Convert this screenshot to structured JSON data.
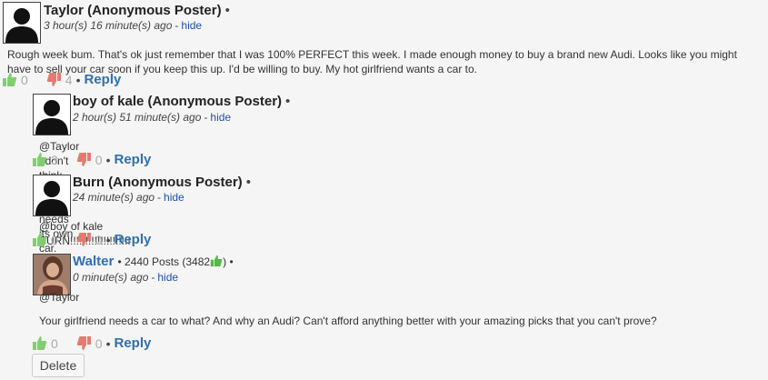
{
  "comments": [
    {
      "author": "Taylor (Anonymous Poster)",
      "bullet": "•",
      "time": "3 hour(s) 16 minute(s) ago",
      "sep": "-",
      "hide": "hide",
      "body": "Rough week bum. That's ok just remember that I was 100% PERFECT this week. I made enough money to buy a brand new Audi. Looks like you might have to sell your car soon if you keep this up. I'd be willing to buy. My hot girlfriend wants a car to.",
      "up": "0",
      "down": "4",
      "reply_sep": "•",
      "reply": "Reply"
    },
    {
      "author": "boy of kale (Anonymous Poster)",
      "bullet": "•",
      "time": "2 hour(s) 51 minute(s) ago",
      "sep": "-",
      "hide": "hide",
      "body": "@Taylor I don't think your hand needs its own car.",
      "up": "3",
      "down": "0",
      "reply_sep": "•",
      "reply": "Reply"
    },
    {
      "author": "Burn (Anonymous Poster)",
      "bullet": "•",
      "time": "24 minute(s) ago",
      "sep": "-",
      "hide": "hide",
      "body": "@boy of kale BURN!!!!!!!!!!!!!!!!!!!!",
      "up": "0",
      "down": "0",
      "reply_sep": "•",
      "reply": "Reply"
    },
    {
      "author": "Walter",
      "bullet": "•",
      "posts": "2440 Posts (3482",
      "posts_close": ")",
      "time": "0 minute(s) ago",
      "sep": "-",
      "hide": "hide",
      "body_line1": "@Taylor",
      "body_line2": "Your girlfriend needs a car to what? And why an Audi? Can't afford anything better with your amazing picks that you can't prove?",
      "up": "0",
      "down": "0",
      "reply_sep": "•",
      "reply": "Reply",
      "delete": "Delete"
    }
  ],
  "icons": {
    "avatar": "anonymous-avatar-icon",
    "thumb_up": "thumbs-up-icon",
    "thumb_down": "thumbs-down-icon"
  },
  "colors": {
    "link": "#2f6fb3",
    "hide_link": "#1f4fb0",
    "thumb_up": "#7fcf6f",
    "thumb_down": "#e57a6f"
  }
}
